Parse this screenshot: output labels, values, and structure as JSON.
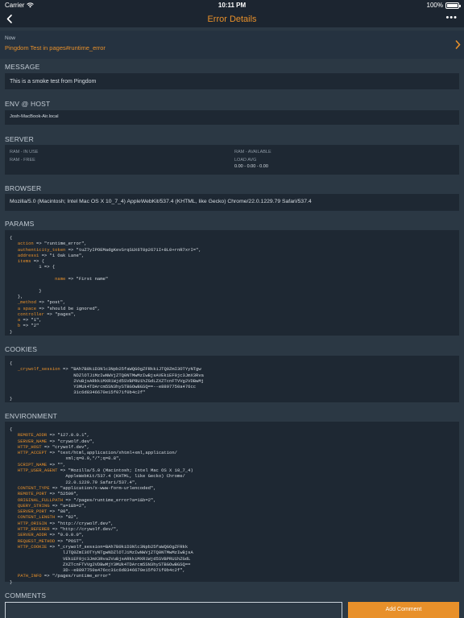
{
  "status_bar": {
    "carrier": "Carrier",
    "time": "10:11 PM",
    "battery": "100%",
    "battery_level": 100
  },
  "nav": {
    "title": "Error Details",
    "more": "•••"
  },
  "notice": {
    "time": "Now",
    "link": "Pingdom Test in pages#runtime_error"
  },
  "sections": {
    "message": "MESSAGE",
    "env_host": "ENV @ HOST",
    "server": "SERVER",
    "browser": "BROWSER",
    "params": "PARAMS",
    "cookies": "COOKIES",
    "environment": "ENVIRONMENT",
    "comments": "COMMENTS"
  },
  "message": "This is a smoke test from Pingdom",
  "env_host": "Josh-MacBook-Air.local",
  "server": {
    "ram_in_use_label": "RAM - IN USE",
    "ram_free_label": "RAM - FREE",
    "ram_available_label": "RAM - AVAILABLE",
    "load_avg_label": "LOAD AVG",
    "load_avg_value": "0.00 - 0.00 - 0.00"
  },
  "browser": "Mozilla/5.0 (Macintosh; Intel Mac OS X 10_7_4) AppleWebKit/537.4 (KHTML, like Gecko) Chrome/22.0.1229.79 Safari/537.4",
  "params_code": [
    {
      "t": "{"
    },
    {
      "t": "",
      "k": "action",
      "v": " => \"runtime_error\","
    },
    {
      "t": "",
      "k": "authenticity_token",
      "v": " => \"tuZ7yIPOEMadgKevSrqSUX6T0p2671I+8L0+rnR7xrI=\","
    },
    {
      "t": "",
      "k": "address1",
      "v": " => \"1 Oak Lane\","
    },
    {
      "t": "",
      "k": "items",
      "v": " => {"
    },
    {
      "t": "",
      "k": "",
      "v": "        1 => {"
    },
    {
      "t": "",
      "k": "",
      "v": ""
    },
    {
      "t": "",
      "k": "",
      "v": "              ",
      "k2": "name",
      "v2": " => \"First name\""
    },
    {
      "t": "",
      "k": "",
      "v": ""
    },
    {
      "t": "",
      "k": "",
      "v": "        }"
    },
    {
      "t": "",
      "k": "",
      "v": "},"
    },
    {
      "t": "",
      "k": "_method",
      "v": " => \"post\","
    },
    {
      "t": "",
      "k": "a space",
      "v": " => \"should be ignored\","
    },
    {
      "t": "",
      "k": "controller",
      "v": " => \"pages\","
    },
    {
      "t": "",
      "k": "a",
      "v": " => \"1\","
    },
    {
      "t": "",
      "k": "b",
      "v": " => \"2\""
    },
    {
      "t": "}"
    }
  ],
  "cookies_code": [
    {
      "t": "{"
    },
    {
      "t": "",
      "k": "_crywolf_session",
      "v": " => \"BAh7B0kiD3Nlc3Npb25faWQGOgZFRkkiJTQ0ZmI3OTYyNTgw"
    },
    {
      "t": "",
      "k": "",
      "v": "                     NDZlOTJiMzIwNWVjZTQ0NTMwMzIwBjsAVEkiEF9jc3JmX3Rva"
    },
    {
      "t": "",
      "k": "",
      "v": "                     2VuBjsARkkiMXR1Wjd5SVBPRU1hZGdLZXZTcnFTVVg2VDBwMj"
    },
    {
      "t": "",
      "k": "",
      "v": "                     Y3MUk4TDArcm5SN3hySTBGOwBGSQ==--e8897750a476cc"
    },
    {
      "t": "",
      "k": "",
      "v": "                     31c6d8346670e15f071f0b4c2f\""
    },
    {
      "t": "}"
    }
  ],
  "environment_code": [
    {
      "t": "{"
    },
    {
      "t": "",
      "k": "REMOTE_ADDR",
      "v": " => \"127.0.0.1\","
    },
    {
      "t": "",
      "k": "SERVER_NAME",
      "v": " => \"crywolf.dev\","
    },
    {
      "t": "",
      "k": "HTTP_HOST",
      "v": " => \"crywolf.dev\","
    },
    {
      "t": "",
      "k": "HTTP_ACCEPT",
      "v": " => \"text/html,application/xhtml+xml,application/"
    },
    {
      "t": "",
      "k": "",
      "v": "                  xml;q=0.9,*/*;q=0.8\","
    },
    {
      "t": "",
      "k": "SCRIPT_NAME",
      "v": " => \"\","
    },
    {
      "t": "",
      "k": "HTTP_USER_AGENT",
      "v": " => \"Mozilla/5.0 (Macintosh; Intel Mac OS X 10_7_4)"
    },
    {
      "t": "",
      "k": "",
      "v": "                  AppleWebKit/537.4 (KHTML, like Gecko) Chrome/"
    },
    {
      "t": "",
      "k": "",
      "v": "                  22.0.1229.79 Safari/537.4\","
    },
    {
      "t": "",
      "k": "CONTENT_TYPE",
      "v": " => \"application/x-www-form-urlencoded\","
    },
    {
      "t": "",
      "k": "REMOTE_PORT",
      "v": " => \"52509\","
    },
    {
      "t": "",
      "k": "ORIGINAL_FULLPATH",
      "v": " => \"/pages/runtime_error?a=1&b=2\","
    },
    {
      "t": "",
      "k": "QUERY_STRING",
      "v": " => \"a=1&b=2\","
    },
    {
      "t": "",
      "k": "SERVER_PORT",
      "v": " => \"80\","
    },
    {
      "t": "",
      "k": "CONTENT_LENGTH",
      "v": " => \"82\","
    },
    {
      "t": "",
      "k": "HTTP_ORIGIN",
      "v": " => \"http://crywolf.dev\","
    },
    {
      "t": "",
      "k": "HTTP_REFERER",
      "v": " => \"http://crywolf.dev/\","
    },
    {
      "t": "",
      "k": "SERVER_ADDR",
      "v": " => \"0.0.0.0\","
    },
    {
      "t": "",
      "k": "REQUEST_METHOD",
      "v": " => \"POST\","
    },
    {
      "t": "",
      "k": "HTTP_COOKIE",
      "v": " => \"_crywolf_session=BAh7B0kiD3Nlc3Npb25faWQGOgZFRkk"
    },
    {
      "t": "",
      "k": "",
      "v": "                 lJTQ0ZmI3OTYyNTgwNDZlOTJiMzIwNWVjZTQ0NTMwMzIwBjsA"
    },
    {
      "t": "",
      "k": "",
      "v": "                 VEkiEF9jc3JmX3Rva2VuBjsARkkiMXR1Wjd5SVBPRU1hZGdL"
    },
    {
      "t": "",
      "k": "",
      "v": "                 ZXZTcnFTVVg2VDBwMjY3MUk4TDArcm5SN3hySTBGOwBGSQ=="
    },
    {
      "t": "",
      "k": "",
      "v": "                 3D--e8897750a476cc31c6d8346670e15f071f0b4c2f\","
    },
    {
      "t": "",
      "k": "PATH_INFO",
      "v": " => \"/pages/runtime_error\""
    },
    {
      "t": "}"
    }
  ],
  "comments": {
    "input_value": "",
    "add_button_label": "Add Comment"
  },
  "colors": {
    "accent": "#e8902a",
    "background": "#2b3844",
    "panel": "#1e2833",
    "bar": "#1c2530"
  }
}
